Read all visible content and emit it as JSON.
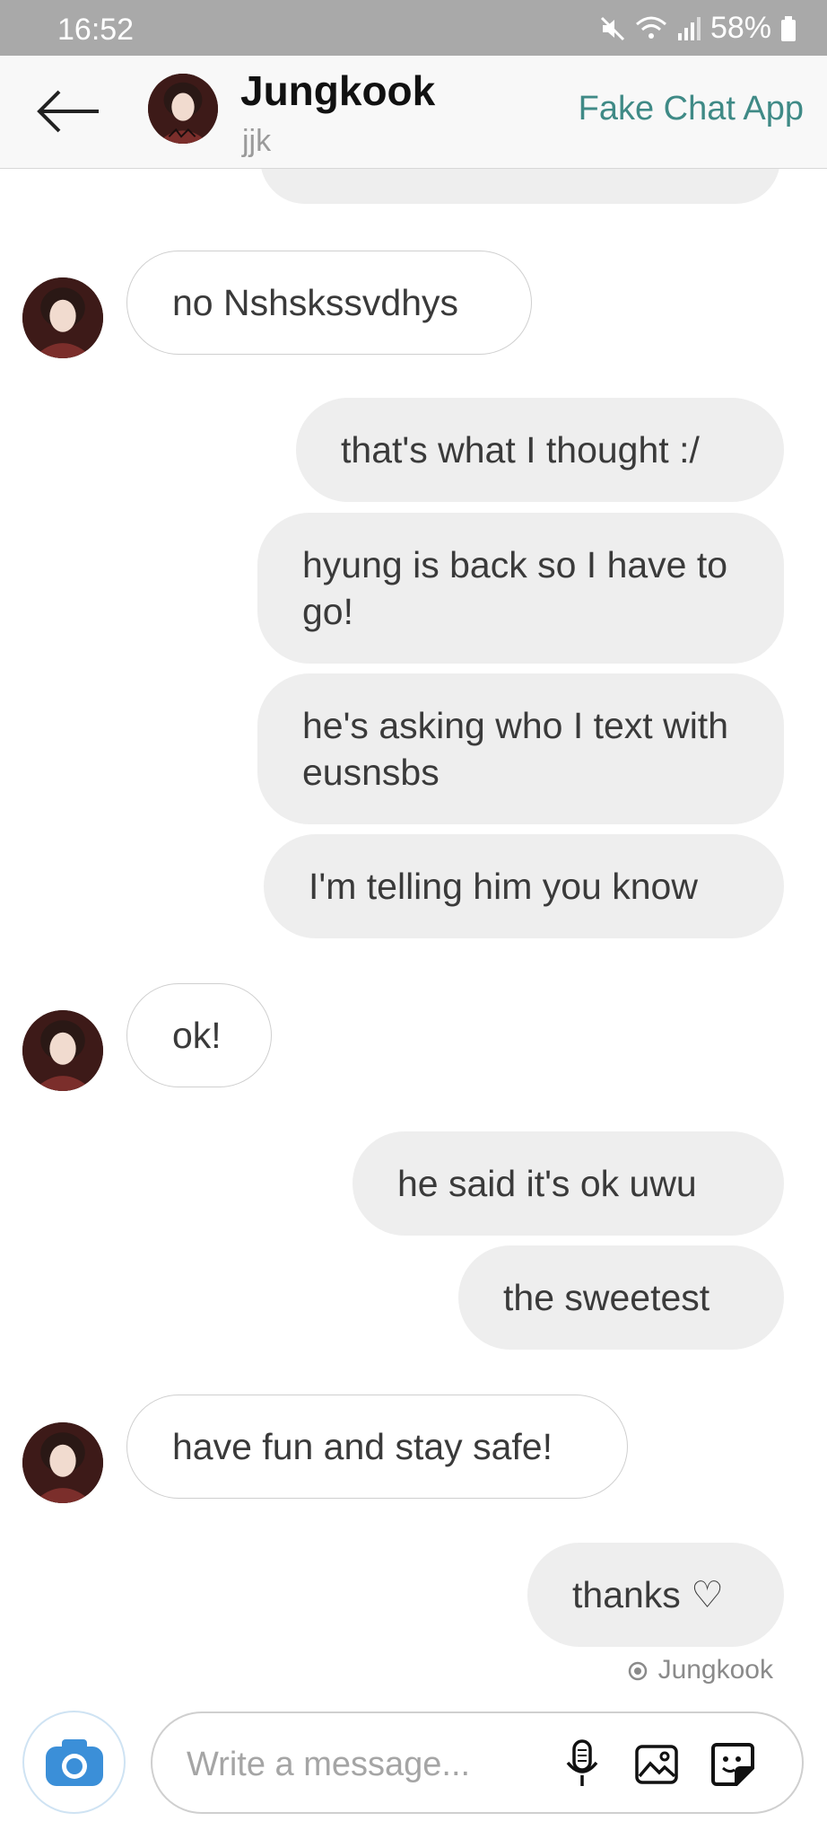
{
  "status_bar": {
    "time": "16:52",
    "battery": "58%"
  },
  "header": {
    "name": "Jungkook",
    "username": "jjk",
    "app_name": "Fake Chat App"
  },
  "messages": [
    {
      "side": "in",
      "text": "no Nshskssvdhys"
    },
    {
      "side": "out",
      "text": "that's what I thought :/"
    },
    {
      "side": "out",
      "text": "hyung is back so I have to go!"
    },
    {
      "side": "out",
      "text": "he's asking who I text with eusnsbs"
    },
    {
      "side": "out",
      "text": "I'm telling him you know"
    },
    {
      "side": "in",
      "text": "ok!"
    },
    {
      "side": "out",
      "text": "he said it's ok uwu"
    },
    {
      "side": "out",
      "text": "the sweetest"
    },
    {
      "side": "in",
      "text": "have fun and stay safe!"
    },
    {
      "side": "out",
      "text": "thanks ♡"
    }
  ],
  "seen_by": "Jungkook",
  "composer": {
    "placeholder": "Write a message..."
  },
  "colors": {
    "accent": "#3f8a86",
    "camera": "#3b8fd8",
    "status_bar": "#a9a9a9"
  },
  "icons": [
    "back-arrow-icon",
    "camera-icon",
    "microphone-icon",
    "image-icon",
    "sticker-icon",
    "eye-icon",
    "mute-icon",
    "wifi-icon",
    "signal-icon",
    "battery-icon"
  ]
}
